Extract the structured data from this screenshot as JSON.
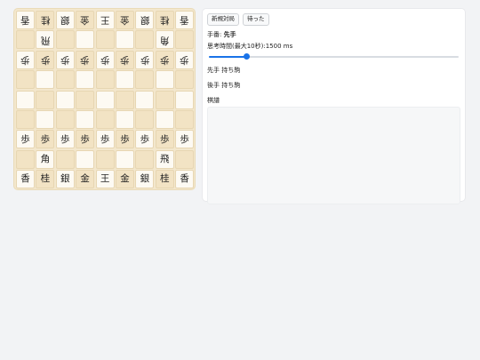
{
  "board": {
    "rows": [
      [
        {
          "p": "香",
          "s": "gote"
        },
        {
          "p": "桂",
          "s": "gote"
        },
        {
          "p": "銀",
          "s": "gote"
        },
        {
          "p": "金",
          "s": "gote"
        },
        {
          "p": "王",
          "s": "gote"
        },
        {
          "p": "金",
          "s": "gote"
        },
        {
          "p": "銀",
          "s": "gote"
        },
        {
          "p": "桂",
          "s": "gote"
        },
        {
          "p": "香",
          "s": "gote"
        }
      ],
      [
        {
          "p": "",
          "s": ""
        },
        {
          "p": "飛",
          "s": "gote"
        },
        {
          "p": "",
          "s": ""
        },
        {
          "p": "",
          "s": ""
        },
        {
          "p": "",
          "s": ""
        },
        {
          "p": "",
          "s": ""
        },
        {
          "p": "",
          "s": ""
        },
        {
          "p": "角",
          "s": "gote"
        },
        {
          "p": "",
          "s": ""
        }
      ],
      [
        {
          "p": "歩",
          "s": "gote"
        },
        {
          "p": "歩",
          "s": "gote"
        },
        {
          "p": "歩",
          "s": "gote"
        },
        {
          "p": "歩",
          "s": "gote"
        },
        {
          "p": "歩",
          "s": "gote"
        },
        {
          "p": "歩",
          "s": "gote"
        },
        {
          "p": "歩",
          "s": "gote"
        },
        {
          "p": "歩",
          "s": "gote"
        },
        {
          "p": "歩",
          "s": "gote"
        }
      ],
      [
        {
          "p": "",
          "s": ""
        },
        {
          "p": "",
          "s": ""
        },
        {
          "p": "",
          "s": ""
        },
        {
          "p": "",
          "s": ""
        },
        {
          "p": "",
          "s": ""
        },
        {
          "p": "",
          "s": ""
        },
        {
          "p": "",
          "s": ""
        },
        {
          "p": "",
          "s": ""
        },
        {
          "p": "",
          "s": ""
        }
      ],
      [
        {
          "p": "",
          "s": ""
        },
        {
          "p": "",
          "s": ""
        },
        {
          "p": "",
          "s": ""
        },
        {
          "p": "",
          "s": ""
        },
        {
          "p": "",
          "s": ""
        },
        {
          "p": "",
          "s": ""
        },
        {
          "p": "",
          "s": ""
        },
        {
          "p": "",
          "s": ""
        },
        {
          "p": "",
          "s": ""
        }
      ],
      [
        {
          "p": "",
          "s": ""
        },
        {
          "p": "",
          "s": ""
        },
        {
          "p": "",
          "s": ""
        },
        {
          "p": "",
          "s": ""
        },
        {
          "p": "",
          "s": ""
        },
        {
          "p": "",
          "s": ""
        },
        {
          "p": "",
          "s": ""
        },
        {
          "p": "",
          "s": ""
        },
        {
          "p": "",
          "s": ""
        }
      ],
      [
        {
          "p": "歩",
          "s": "sente"
        },
        {
          "p": "歩",
          "s": "sente"
        },
        {
          "p": "歩",
          "s": "sente"
        },
        {
          "p": "歩",
          "s": "sente"
        },
        {
          "p": "歩",
          "s": "sente"
        },
        {
          "p": "歩",
          "s": "sente"
        },
        {
          "p": "歩",
          "s": "sente"
        },
        {
          "p": "歩",
          "s": "sente"
        },
        {
          "p": "歩",
          "s": "sente"
        }
      ],
      [
        {
          "p": "",
          "s": ""
        },
        {
          "p": "角",
          "s": "sente"
        },
        {
          "p": "",
          "s": ""
        },
        {
          "p": "",
          "s": ""
        },
        {
          "p": "",
          "s": ""
        },
        {
          "p": "",
          "s": ""
        },
        {
          "p": "",
          "s": ""
        },
        {
          "p": "飛",
          "s": "sente"
        },
        {
          "p": "",
          "s": ""
        }
      ],
      [
        {
          "p": "香",
          "s": "sente"
        },
        {
          "p": "桂",
          "s": "sente"
        },
        {
          "p": "銀",
          "s": "sente"
        },
        {
          "p": "金",
          "s": "sente"
        },
        {
          "p": "王",
          "s": "sente"
        },
        {
          "p": "金",
          "s": "sente"
        },
        {
          "p": "銀",
          "s": "sente"
        },
        {
          "p": "桂",
          "s": "sente"
        },
        {
          "p": "香",
          "s": "sente"
        }
      ]
    ]
  },
  "panel": {
    "new_game_label": "新規対局",
    "undo_label": "待った",
    "turn_label": "手番: ",
    "turn_value": "先手",
    "think_label": "思考時間(最大10秒):1500 ms",
    "think_ms": 1500,
    "think_max_ms": 10000,
    "sente_hand_label": "先手 持ち駒",
    "gote_hand_label": "後手 持ち駒",
    "kifu_label": "棋譜"
  },
  "colors": {
    "accent": "#1a73e8",
    "board_light": "#fdfaf3",
    "board_dark": "#f2e3c4"
  }
}
